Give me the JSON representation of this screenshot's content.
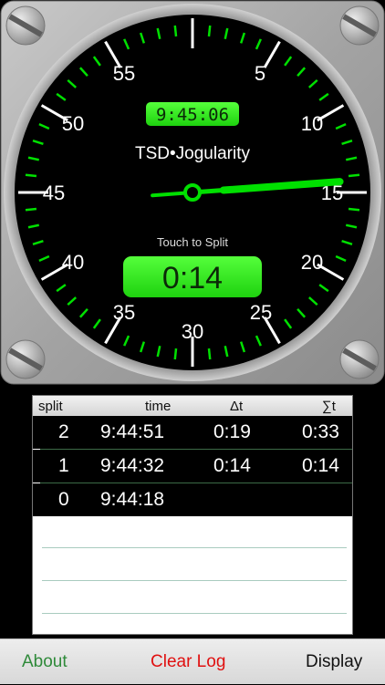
{
  "clock": {
    "time": "9:45:06",
    "title": "TSD•Jogularity",
    "split_prompt": "Touch to Split",
    "split_elapsed": "0:14",
    "dial_numbers": [
      "55",
      "5",
      "50",
      "10",
      "45",
      "15",
      "40",
      "20",
      "35",
      "25",
      "30"
    ],
    "hand_minute_position": 14.3,
    "colors": {
      "accent": "#00e000",
      "bezel": "#a8a8a8",
      "face": "#000000"
    }
  },
  "log": {
    "headers": {
      "split": "split",
      "time": "time",
      "delta": "Δt",
      "total": "∑t"
    },
    "rows": [
      {
        "split": "2",
        "time": "9:44:51",
        "delta": "0:19",
        "total": "0:33"
      },
      {
        "split": "1",
        "time": "9:44:32",
        "delta": "0:14",
        "total": "0:14"
      },
      {
        "split": "0",
        "time": "9:44:18",
        "delta": "",
        "total": ""
      }
    ]
  },
  "toolbar": {
    "about": "About",
    "clear_log": "Clear Log",
    "display": "Display",
    "colors": {
      "about": "#2f8a3a",
      "clear_log": "#e01010",
      "display": "#111111"
    }
  },
  "icons": [
    "screw-icon"
  ]
}
